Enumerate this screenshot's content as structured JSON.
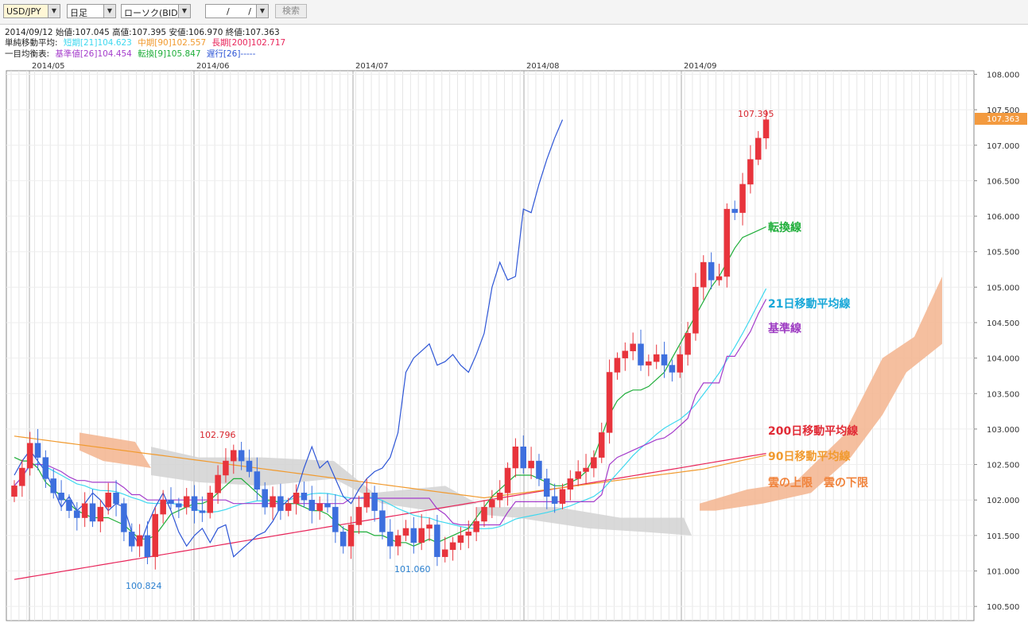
{
  "toolbar": {
    "pair": "USD/JPY",
    "timeframe": "日足",
    "chart_type": "ローソク(BID)",
    "date_value": "/ /",
    "search_label": "検索"
  },
  "info": {
    "ohlc": "2014/09/12  始値:107.045  高値:107.395  安値:106.970  終値:107.363",
    "sma_title": "単純移動平均:",
    "sma_short": "短期[21]104.623",
    "sma_mid": "中期[90]102.557",
    "sma_long": "長期[200]102.717",
    "ichimoku_title": "一目均衡表:",
    "kijun": "基準値[26]104.454",
    "tenkan": "転換[9]105.847",
    "chikou": "遅行[26]-----"
  },
  "colors": {
    "up": "#e8343c",
    "down": "#3d6fde",
    "sma21": "#3ed8ef",
    "sma90": "#f19a2e",
    "sma200": "#e8255a",
    "tenkan": "#1fae3a",
    "kijun": "#a43ccb",
    "chikou": "#2d55d6",
    "cloud_up": "#f3b48e",
    "cloud_down": "#d2d2d2",
    "last_price_bg": "#f39a3f"
  },
  "chart_data": {
    "type": "candlestick",
    "symbol": "USD/JPY",
    "ylim": [
      100.3,
      108.05
    ],
    "y_ticks": [
      "108.000",
      "107.500",
      "107.000",
      "106.500",
      "106.000",
      "105.500",
      "105.000",
      "104.500",
      "104.000",
      "103.500",
      "103.000",
      "102.500",
      "102.000",
      "101.500",
      "101.000",
      "100.500"
    ],
    "x_labels": [
      "2014/05",
      "2014/06",
      "2014/07",
      "2014/08",
      "2014/09"
    ],
    "last_price": "107.363",
    "marked_high": "107.395",
    "marked_low_1": "100.824",
    "marked_low_2": "101.060",
    "marked_mid": "102.796",
    "annotations": {
      "tenkan": "転換線",
      "sma21": "21日移動平均線",
      "kijun": "基準線",
      "sma200": "200日移動平均線",
      "sma90": "90日移動平均線",
      "cloud": "雲の上限　雲の下限"
    },
    "series_close": [
      102.2,
      102.45,
      102.8,
      102.6,
      102.3,
      102.1,
      102.0,
      101.85,
      101.75,
      101.95,
      101.7,
      101.9,
      102.1,
      101.95,
      101.55,
      101.35,
      101.5,
      101.2,
      101.8,
      102.0,
      101.95,
      101.9,
      102.05,
      101.85,
      101.82,
      102.1,
      102.35,
      102.55,
      102.7,
      102.55,
      102.4,
      102.15,
      101.9,
      102.05,
      101.85,
      101.95,
      102.1,
      102.0,
      101.85,
      101.95,
      101.9,
      101.55,
      101.35,
      101.65,
      101.9,
      102.1,
      101.85,
      101.55,
      101.35,
      101.5,
      101.6,
      101.4,
      101.6,
      101.65,
      101.2,
      101.3,
      101.4,
      101.5,
      101.55,
      101.7,
      101.9,
      102.0,
      102.1,
      102.45,
      102.75,
      102.45,
      102.55,
      102.3,
      102.05,
      101.95,
      102.15,
      102.3,
      102.4,
      102.45,
      102.6,
      102.95,
      103.8,
      104.0,
      104.1,
      104.2,
      103.9,
      103.95,
      104.05,
      103.9,
      103.8,
      104.05,
      104.35,
      105.0,
      105.35,
      105.1,
      105.15,
      106.1,
      106.05,
      106.45,
      106.8,
      107.1,
      107.36
    ],
    "series_tenkan": [
      102.6,
      102.55,
      102.55,
      102.45,
      102.25,
      102.15,
      102.05,
      101.95,
      101.85,
      101.8,
      101.75,
      101.75,
      101.75,
      101.7,
      101.65,
      101.55,
      101.45,
      101.45,
      101.5,
      101.65,
      101.8,
      101.85,
      101.9,
      101.95,
      101.95,
      102.0,
      102.1,
      102.2,
      102.3,
      102.3,
      102.2,
      102.1,
      102.0,
      102.0,
      101.95,
      101.95,
      101.95,
      101.9,
      101.85,
      101.85,
      101.8,
      101.7,
      101.6,
      101.55,
      101.55,
      101.55,
      101.5,
      101.5,
      101.45,
      101.4,
      101.4,
      101.35,
      101.4,
      101.45,
      101.4,
      101.45,
      101.5,
      101.55,
      101.6,
      101.75,
      101.9,
      102.05,
      102.15,
      102.25,
      102.35,
      102.35,
      102.35,
      102.3,
      102.25,
      102.2,
      102.2,
      102.25,
      102.3,
      102.4,
      102.6,
      102.9,
      103.2,
      103.4,
      103.5,
      103.55,
      103.55,
      103.6,
      103.7,
      103.8,
      104.0,
      104.2,
      104.4,
      104.6,
      104.8,
      105.0,
      105.15,
      105.35,
      105.55,
      105.7,
      105.75,
      105.8,
      105.85
    ]
  }
}
